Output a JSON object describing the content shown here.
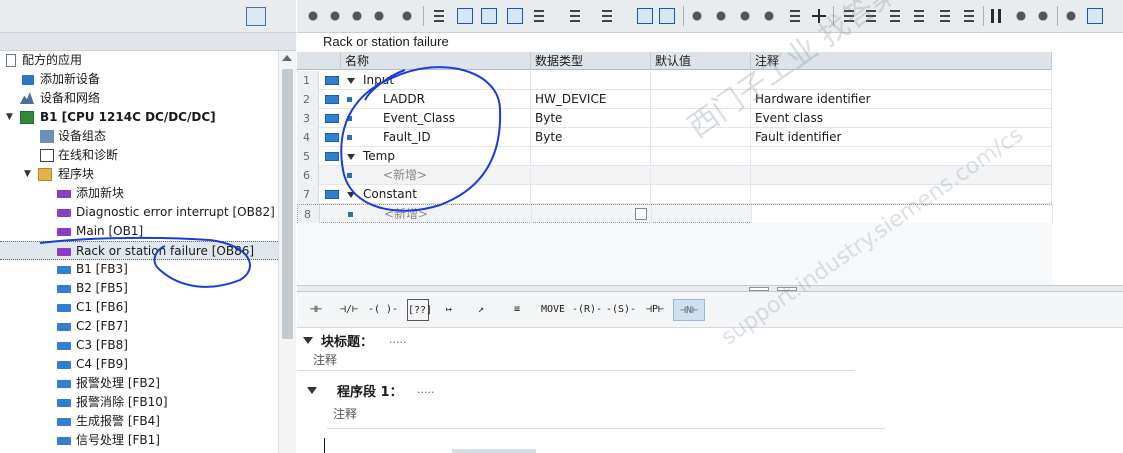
{
  "tree": {
    "items": [
      {
        "label": "配方的应用",
        "level": 0
      },
      {
        "label": "添加新设备",
        "level": 1
      },
      {
        "label": "设备和网络",
        "level": 1
      },
      {
        "label": "B1 [CPU 1214C DC/DC/DC]",
        "level": 1
      },
      {
        "label": "设备组态",
        "level": 2
      },
      {
        "label": "在线和诊断",
        "level": 2
      },
      {
        "label": "程序块",
        "level": 2
      },
      {
        "label": "添加新块",
        "level": 3
      },
      {
        "label": "Diagnostic error interrupt [OB82]",
        "level": 3
      },
      {
        "label": "Main [OB1]",
        "level": 3
      },
      {
        "label": "Rack or station failure [OB86]",
        "level": 3,
        "selected": true
      },
      {
        "label": "B1 [FB3]",
        "level": 3
      },
      {
        "label": "B2 [FB5]",
        "level": 3
      },
      {
        "label": "C1 [FB6]",
        "level": 3
      },
      {
        "label": "C2 [FB7]",
        "level": 3
      },
      {
        "label": "C3 [FB8]",
        "level": 3
      },
      {
        "label": "C4 [FB9]",
        "level": 3
      },
      {
        "label": "报警处理 [FB2]",
        "level": 3
      },
      {
        "label": "报警消除 [FB10]",
        "level": 3
      },
      {
        "label": "生成报警 [FB4]",
        "level": 3
      },
      {
        "label": "信号处理 [FB1]",
        "level": 3
      }
    ]
  },
  "editor": {
    "block_title": "Rack or station failure",
    "columns": [
      "名称",
      "数据类型",
      "默认值",
      "注释"
    ],
    "rows": [
      {
        "num": "1",
        "name": "Input",
        "type": "",
        "default": "",
        "comment": "",
        "kind": "section"
      },
      {
        "num": "2",
        "name": "LADDR",
        "type": "HW_DEVICE",
        "default": "",
        "comment": "Hardware identifier",
        "kind": "var"
      },
      {
        "num": "3",
        "name": "Event_Class",
        "type": "Byte",
        "default": "",
        "comment": "Event class",
        "kind": "var"
      },
      {
        "num": "4",
        "name": "Fault_ID",
        "type": "Byte",
        "default": "",
        "comment": "Fault identifier",
        "kind": "var"
      },
      {
        "num": "5",
        "name": "Temp",
        "type": "",
        "default": "",
        "comment": "",
        "kind": "section"
      },
      {
        "num": "6",
        "name": "<新增>",
        "type": "",
        "default": "",
        "comment": "",
        "kind": "add"
      },
      {
        "num": "7",
        "name": "Constant",
        "type": "",
        "default": "",
        "comment": "",
        "kind": "section"
      },
      {
        "num": "8",
        "name": "<新增>",
        "type": "",
        "default": "",
        "comment": "",
        "kind": "add"
      }
    ]
  },
  "lad_toolbar": {
    "items": [
      "⊣⊢",
      "⊣/⊢",
      "-( )-",
      "[??]",
      "↦",
      "↗",
      "≡",
      "MOVE",
      "-(R)-",
      "-(S)-",
      "⊣P⊢",
      "⊣N⊢"
    ]
  },
  "block_section": {
    "heading": "块标题：",
    "dots": ".....",
    "comment": "注释"
  },
  "network": {
    "heading": "程序段 1：",
    "dots": ".....",
    "comment": "注释"
  },
  "watermark": {
    "line1": "西门子工业  找答案",
    "line2": "support.industry.siemens.com/cs"
  }
}
